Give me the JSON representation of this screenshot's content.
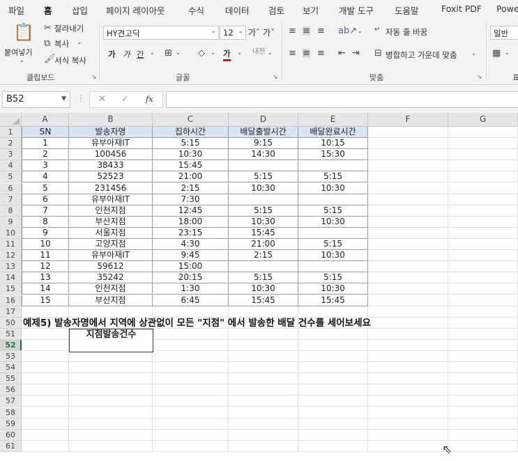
{
  "menu": {
    "tabs": [
      "파일",
      "홈",
      "삽입",
      "페이지 레이아웃",
      "수식",
      "데이터",
      "검토",
      "보기",
      "개발 도구",
      "도움말",
      "Foxit PDF",
      "Powe"
    ],
    "active_index": 1
  },
  "ribbon": {
    "clipboard": {
      "paste": "붙여넣기",
      "cut": "잘라내기",
      "copy": "복사",
      "format_painter": "서식 복사",
      "label": "클립보드"
    },
    "font": {
      "font_name": "HY견고딕",
      "font_size": "12",
      "bold": "가",
      "italic": "가",
      "underline": "간",
      "font_color_glyph": "가",
      "label": "글꼴"
    },
    "alignment": {
      "wrap_text": "자동 줄 바꿈",
      "merge_center": "병합하고 가운데 맞춤",
      "label": "맞춤"
    },
    "number": {
      "format": "일반",
      "label": "표"
    }
  },
  "formula_bar": {
    "name_box": "B52",
    "cancel": "✕",
    "enter": "✓",
    "fx": "fx",
    "value": ""
  },
  "columns": [
    "A",
    "B",
    "C",
    "D",
    "E",
    "F",
    "G"
  ],
  "row_numbers": [
    "1",
    "2",
    "3",
    "4",
    "5",
    "6",
    "7",
    "8",
    "9",
    "10",
    "11",
    "12",
    "13",
    "14",
    "15",
    "16",
    "17",
    "50",
    "51",
    "52",
    "53",
    "54",
    "55",
    "56",
    "57",
    "58",
    "59",
    "60",
    "61"
  ],
  "selected_row": "52",
  "table": {
    "headers": [
      "SN",
      "발송자명",
      "집하시간",
      "배달출발시간",
      "배달완료시간"
    ],
    "rows": [
      [
        "1",
        "유부아재IT",
        "5:15",
        "9:15",
        "10:15"
      ],
      [
        "2",
        "100456",
        "10:30",
        "14:30",
        "15:30"
      ],
      [
        "3",
        "38433",
        "15:45",
        "",
        ""
      ],
      [
        "4",
        "52523",
        "21:00",
        "5:15",
        "5:15"
      ],
      [
        "5",
        "231456",
        "2:15",
        "10:30",
        "10:30"
      ],
      [
        "6",
        "유부아재IT",
        "7:30",
        "",
        ""
      ],
      [
        "7",
        "인천지점",
        "12:45",
        "5:15",
        "5:15"
      ],
      [
        "8",
        "부산지점",
        "18:00",
        "10:30",
        "10:30"
      ],
      [
        "9",
        "서울지점",
        "23:15",
        "15:45",
        ""
      ],
      [
        "10",
        "고양지점",
        "4:30",
        "21:00",
        "5:15"
      ],
      [
        "11",
        "유부아재IT",
        "9:45",
        "2:15",
        "10:30"
      ],
      [
        "12",
        "59612",
        "15:00",
        "",
        ""
      ],
      [
        "13",
        "35242",
        "20:15",
        "5:15",
        "5:15"
      ],
      [
        "14",
        "인천지점",
        "1:30",
        "10:30",
        "10:30"
      ],
      [
        "15",
        "부산지점",
        "6:45",
        "15:45",
        "15:45"
      ]
    ]
  },
  "question": "예제5)   발송자명에서 지역에 상관없이 모든 \"지점\" 에서 발송한 배달 건수를 세어보세요",
  "answer_header": "지점발송건수",
  "answer_value": ""
}
